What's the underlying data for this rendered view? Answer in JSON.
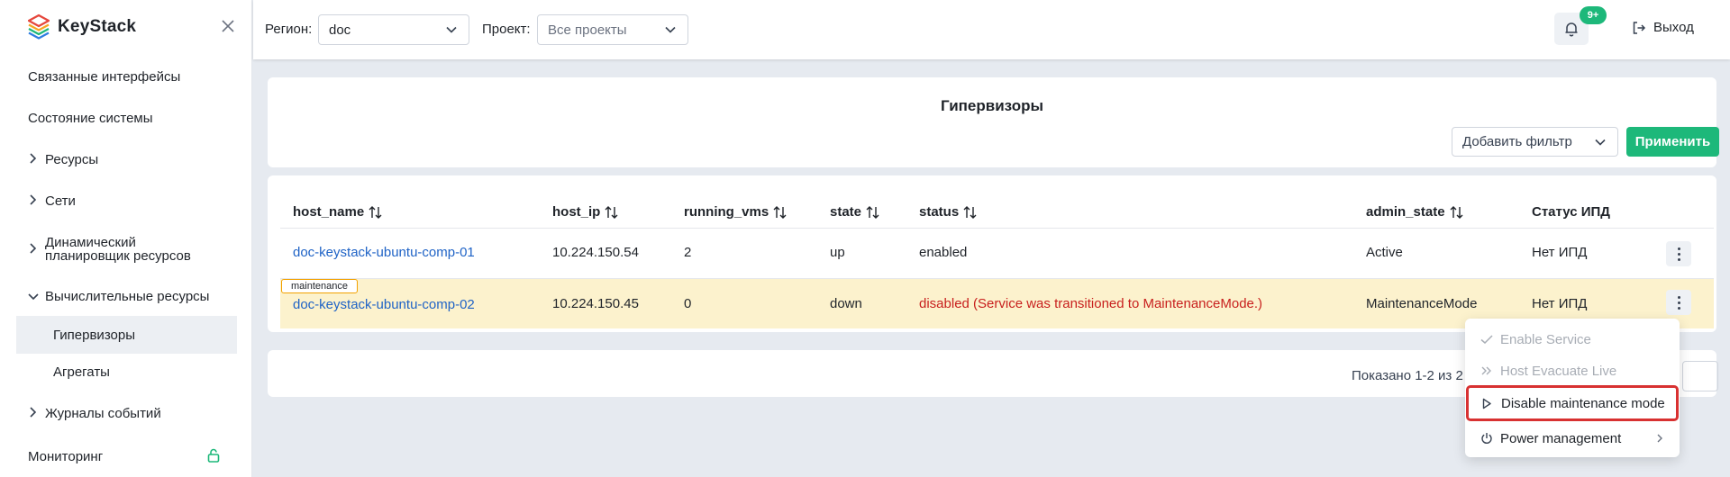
{
  "app": {
    "name": "KeyStack"
  },
  "sidebar": {
    "items": [
      {
        "label": "Связанные интерфейсы"
      },
      {
        "label": "Состояние системы"
      },
      {
        "label": "Ресурсы"
      },
      {
        "label": "Сети"
      },
      {
        "label": "Динамический планировщик ресурсов"
      },
      {
        "label": "Вычислительные ресурсы"
      },
      {
        "label": "Гипервизоры"
      },
      {
        "label": "Агрегаты"
      },
      {
        "label": "Журналы событий"
      },
      {
        "label": "Мониторинг"
      }
    ]
  },
  "header": {
    "region_label": "Регион:",
    "region_value": "doc",
    "project_label": "Проект:",
    "project_value": "Все проекты",
    "notifications_badge": "9+",
    "logout_label": "Выход"
  },
  "page": {
    "title": "Гипервизоры",
    "filter_placeholder": "Добавить фильтр",
    "apply_label": "Применить"
  },
  "table": {
    "columns": [
      "host_name",
      "host_ip",
      "running_vms",
      "state",
      "status",
      "admin_state",
      "Статус ИПД"
    ],
    "rows": [
      {
        "host_name": "doc-keystack-ubuntu-comp-01",
        "host_ip": "10.224.150.54",
        "running_vms": "2",
        "state": "up",
        "status": "enabled",
        "admin_state": "Active",
        "ipd": "Нет ИПД"
      },
      {
        "tag": "maintenance",
        "host_name": "doc-keystack-ubuntu-comp-02",
        "host_ip": "10.224.150.45",
        "running_vms": "0",
        "state": "down",
        "status": "disabled (Service was transitioned to MaintenanceMode.)",
        "admin_state": "MaintenanceMode",
        "ipd": "Нет ИПД"
      }
    ]
  },
  "pagination": {
    "summary": "Показано 1-2 из 2"
  },
  "row_menu": {
    "items": [
      {
        "label": "Enable Service",
        "disabled": true
      },
      {
        "label": "Host Evacuate Live",
        "disabled": true
      },
      {
        "label": "Disable maintenance mode",
        "disabled": false
      },
      {
        "label": "Power management",
        "disabled": false
      }
    ]
  },
  "colors": {
    "accent": "#1db87a",
    "link": "#1f63c6",
    "error": "#c8201e",
    "highlight_row": "#fcf2cd",
    "focus_outline": "#d83131"
  }
}
